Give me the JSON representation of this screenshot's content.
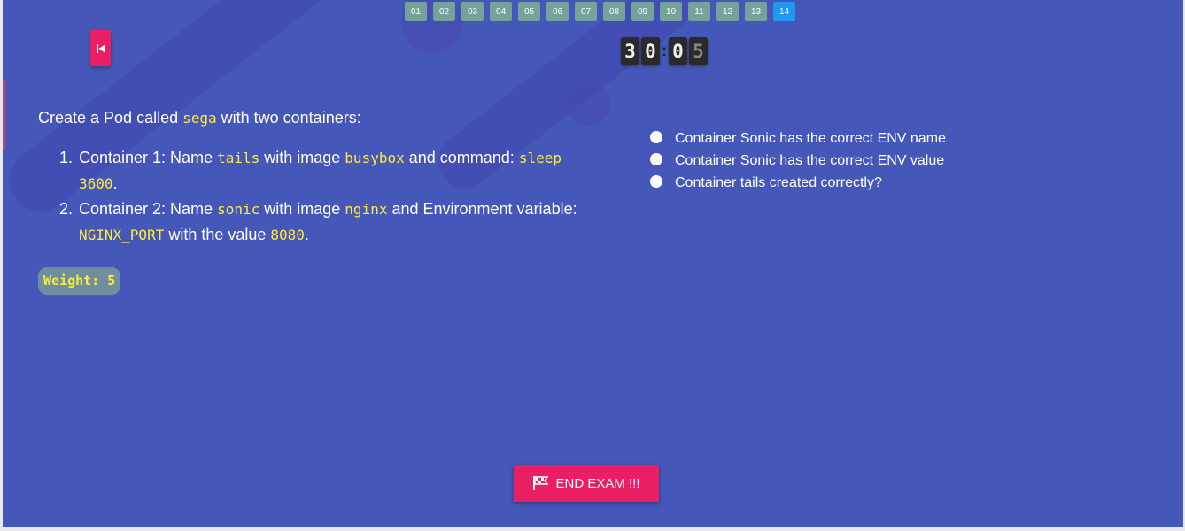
{
  "nav": {
    "questions": [
      "01",
      "02",
      "03",
      "04",
      "05",
      "06",
      "07",
      "08",
      "09",
      "10",
      "11",
      "12",
      "13",
      "14"
    ],
    "active_index": 13
  },
  "timer": {
    "d1": "3",
    "d2": "0",
    "d3": "0",
    "d4": "5",
    "separator": ":"
  },
  "question": {
    "intro_pre": "Create a Pod called ",
    "intro_code": "sega",
    "intro_post": " with two containers:",
    "item1": {
      "num": "1.",
      "t1": "Container 1: Name ",
      "c1": "tails",
      "t2": " with image ",
      "c2": "busybox",
      "t3": " and command: ",
      "c3": "sleep 3600",
      "t4": "."
    },
    "item2": {
      "num": "2.",
      "t1": "Container 2: Name ",
      "c1": "sonic",
      "t2": " with image ",
      "c2": "nginx",
      "t3": " and Environment variable: ",
      "c3": "NGINX_PORT",
      "t4": " with the value ",
      "c4": "8080",
      "t5": "."
    }
  },
  "weight": "Weight: 5",
  "checks": [
    "Container Sonic has the correct ENV name",
    "Container Sonic has the correct ENV value",
    "Container tails created correctly?"
  ],
  "end_button": {
    "label": "END EXAM !!!",
    "icon": "flag-icon"
  },
  "colors": {
    "background": "#4558b9",
    "accent": "#e91e63",
    "active_tab": "#2196f3",
    "tab": "#75a29a",
    "code": "#ffeb3b"
  }
}
